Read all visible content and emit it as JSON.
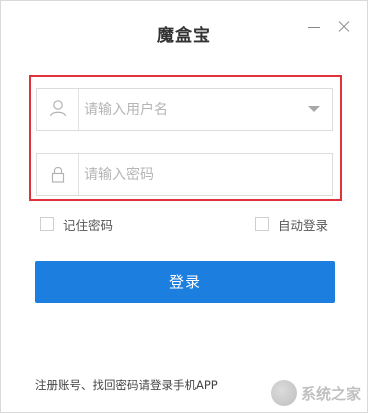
{
  "window": {
    "title": "魔盒宝"
  },
  "controls": {
    "minimize_icon": "minimize-icon",
    "close_icon": "close-icon"
  },
  "username": {
    "placeholder": "请输入用户名",
    "icon": "user-icon",
    "dropdown_icon": "chevron-down-icon"
  },
  "password": {
    "placeholder": "请输入密码",
    "icon": "lock-icon"
  },
  "options": {
    "remember_label": "记住密码",
    "auto_login_label": "自动登录"
  },
  "login_button": {
    "label": "登录",
    "color": "#1c7fe0"
  },
  "footer": {
    "text": "注册账号、找回密码请登录手机APP"
  },
  "watermark": {
    "text": "系统之家"
  },
  "highlight_color": "#e0323a"
}
